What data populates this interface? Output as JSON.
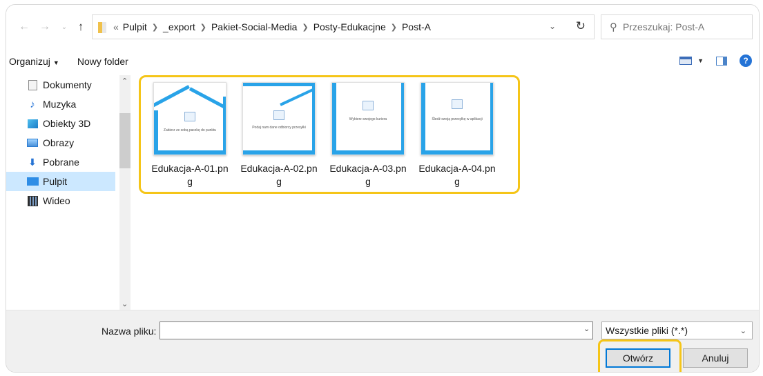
{
  "address_bar": {
    "overflow": "«",
    "crumbs": [
      "Pulpit",
      "_export",
      "Pakiet-Social-Media",
      "Posty-Edukacjne",
      "Post-A"
    ],
    "search_placeholder": "Przeszukaj: Post-A"
  },
  "toolbar": {
    "organize_label": "Organizuj",
    "new_folder_label": "Nowy folder"
  },
  "nav": {
    "items": [
      {
        "label": "Dokumenty",
        "icon": "document-icon"
      },
      {
        "label": "Muzyka",
        "icon": "music-icon"
      },
      {
        "label": "Obiekty 3D",
        "icon": "3d-objects-icon"
      },
      {
        "label": "Obrazy",
        "icon": "pictures-icon"
      },
      {
        "label": "Pobrane",
        "icon": "download-icon"
      },
      {
        "label": "Pulpit",
        "icon": "desktop-icon",
        "selected": true
      },
      {
        "label": "Wideo",
        "icon": "video-icon"
      }
    ]
  },
  "files": [
    {
      "name": "Edukacja-A-01.png",
      "thumb_text": "Zabierz ze sobą paczkę do punktu"
    },
    {
      "name": "Edukacja-A-02.png",
      "thumb_text": "Podaj nam dane odbiorcy przesyłki"
    },
    {
      "name": "Edukacja-A-03.png",
      "thumb_text": "Wybierz swojego kuriera"
    },
    {
      "name": "Edukacja-A-04.png",
      "thumb_text": "Śledź swoją przesyłkę w aplikacji"
    }
  ],
  "bottom": {
    "filename_label": "Nazwa pliku:",
    "filename_value": "",
    "filetype_value": "Wszystkie pliki (*.*)",
    "open_label": "Otwórz",
    "cancel_label": "Anuluj"
  },
  "colors": {
    "highlight": "#f5c518",
    "accent": "#0078d7",
    "selection": "#cce8ff",
    "thumb_blue": "#29a3e8"
  }
}
